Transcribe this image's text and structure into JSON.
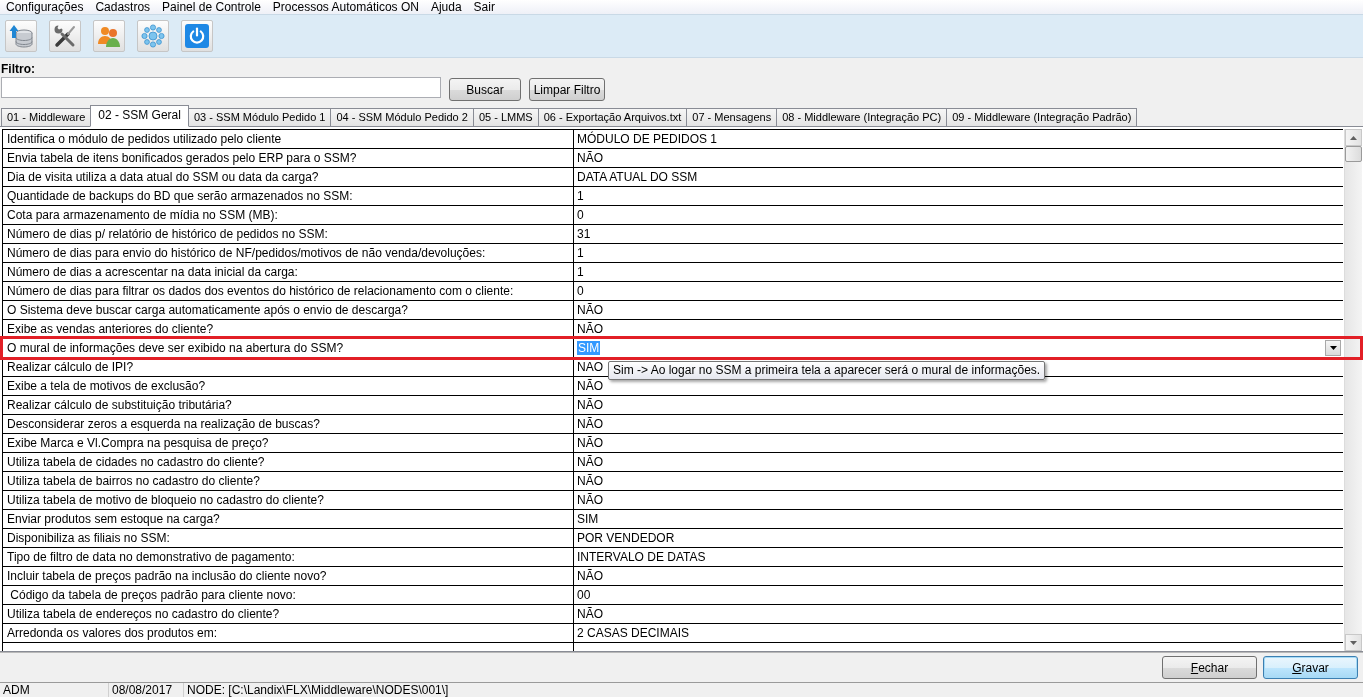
{
  "menu_bar": {
    "items": [
      "Configurações",
      "Cadastros",
      "Painel de Controle",
      "Processos Automáticos ON",
      "Ajuda",
      "Sair"
    ]
  },
  "filter": {
    "label": "Filtro:",
    "buttons": [
      "Buscar",
      "Limpar Filtro"
    ]
  },
  "tabs": [
    {
      "label": "01 - Middleware",
      "selected": false
    },
    {
      "label": "02 - SSM Geral",
      "selected": true
    },
    {
      "label": "03 - SSM Módulo Pedido 1",
      "selected": false
    },
    {
      "label": "04 - SSM Módulo Pedido 2",
      "selected": false
    },
    {
      "label": "05 - LMMS",
      "selected": false
    },
    {
      "label": "06 - Exportação Arquivos.txt",
      "selected": false
    },
    {
      "label": "07 - Mensagens",
      "selected": false
    },
    {
      "label": "08 - Middleware (Integração PC)",
      "selected": false
    },
    {
      "label": "09 - Middleware (Integração Padrão)",
      "selected": false
    }
  ],
  "settings_table": {
    "rows": [
      {
        "label": "Identifica o módulo de pedidos utilizado pelo cliente",
        "value": "MÓDULO DE PEDIDOS 1",
        "selected": false
      },
      {
        "label": "Envia tabela de itens bonificados gerados pelo ERP para o SSM?",
        "value": "NÃO",
        "selected": false
      },
      {
        "label": "Dia de visita utiliza a data atual do SSM ou data da carga?",
        "value": "DATA ATUAL DO SSM",
        "selected": false
      },
      {
        "label": "Quantidade de backups do BD que serão armazenados no SSM:",
        "value": "1",
        "selected": false
      },
      {
        "label": "Cota para armazenamento de mídia no SSM (MB):",
        "value": "0",
        "selected": false
      },
      {
        "label": "Número de dias p/ relatório de histórico de pedidos no SSM:",
        "value": "31",
        "selected": false
      },
      {
        "label": "Número de dias para envio do histórico de NF/pedidos/motivos de não venda/devoluções:",
        "value": "1",
        "selected": false
      },
      {
        "label": "Número de dias a acrescentar na data inicial da carga:",
        "value": "1",
        "selected": false
      },
      {
        "label": "Número de dias para filtrar os dados dos eventos do histórico de relacionamento com o cliente:",
        "value": "0",
        "selected": false
      },
      {
        "label": "O Sistema deve buscar carga automaticamente após o envio de descarga?",
        "value": "NÃO",
        "selected": false
      },
      {
        "label": "Exibe as vendas anteriores do cliente?",
        "value": "NÃO",
        "selected": false
      },
      {
        "label": "O mural de informações deve ser exibido na abertura do SSM?",
        "value": "SIM",
        "selected": true
      },
      {
        "label": "Realizar cálculo de IPI?",
        "value": "NAO",
        "selected": false
      },
      {
        "label": "Exibe a tela de motivos de exclusão?",
        "value": "NÃO",
        "selected": false
      },
      {
        "label": "Realizar cálculo de substituição tributária?",
        "value": "NÃO",
        "selected": false
      },
      {
        "label": "Desconsiderar zeros a esquerda na realização de buscas?",
        "value": "NÃO",
        "selected": false
      },
      {
        "label": "Exibe Marca e Vl.Compra na pesquisa de preço?",
        "value": "NÃO",
        "selected": false
      },
      {
        "label": "Utiliza tabela de cidades no cadastro do cliente?",
        "value": "NÃO",
        "selected": false
      },
      {
        "label": "Utiliza tabela de bairros no cadastro do cliente?",
        "value": "NÃO",
        "selected": false
      },
      {
        "label": "Utiliza tabela de motivo de bloqueio no cadastro do cliente?",
        "value": "NÃO",
        "selected": false
      },
      {
        "label": "Enviar produtos sem estoque na carga?",
        "value": "SIM",
        "selected": false
      },
      {
        "label": "Disponibiliza as filiais no SSM:",
        "value": "POR VENDEDOR",
        "selected": false
      },
      {
        "label": "Tipo de filtro de data no demonstrativo de pagamento:",
        "value": "INTERVALO DE DATAS",
        "selected": false
      },
      {
        "label": "Incluir tabela de preços padrão na inclusão do cliente novo?",
        "value": "NÃO",
        "selected": false
      },
      {
        "label": " Código da tabela de preços padrão para cliente novo:",
        "value": "00",
        "selected": false
      },
      {
        "label": "Utiliza tabela de endereços no cadastro do cliente?",
        "value": "NÃO",
        "selected": false
      },
      {
        "label": "Arredonda os valores dos produtos em:",
        "value": "2 CASAS DECIMAIS",
        "selected": false
      }
    ]
  },
  "tooltip": {
    "text": "Sim -> Ao logar no SSM a primeira tela a aparecer será o mural de informações."
  },
  "footer_buttons": [
    {
      "label": "Fechar",
      "focused": false
    },
    {
      "label": "Gravar",
      "focused": true
    }
  ],
  "status_bar": [
    "ADM",
    "08/08/2017",
    "NODE: [C:\\Landix\\FLX\\Middleware\\NODES\\001\\]"
  ]
}
